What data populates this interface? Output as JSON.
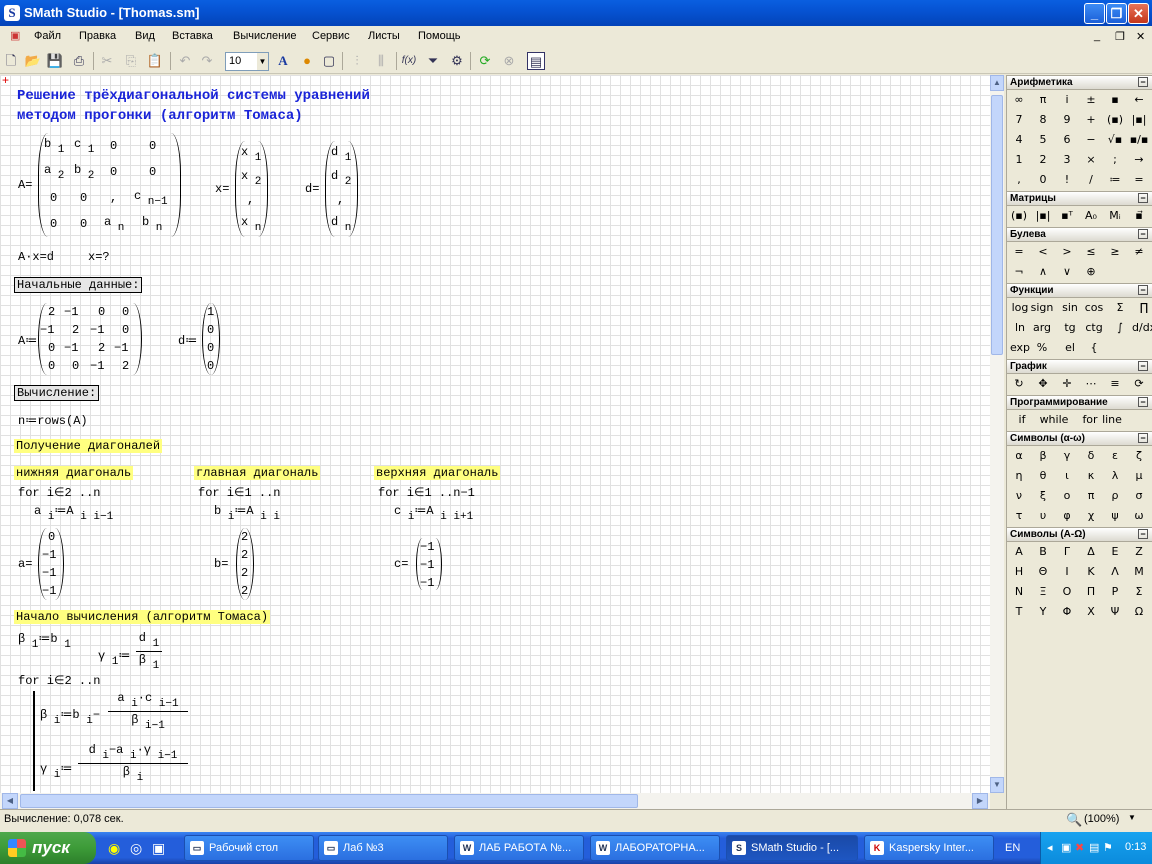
{
  "window": {
    "title": "SMath Studio - [Thomas.sm]",
    "app_icon": "S",
    "btn_min": "_",
    "btn_max": "❐",
    "btn_close": "✕"
  },
  "menu": [
    "Файл",
    "Правка",
    "Вид",
    "Вставка",
    "Вычисление",
    "Сервис",
    "Листы",
    "Помощь"
  ],
  "mdi": {
    "min": "_",
    "restore": "❐",
    "close": "✕"
  },
  "toolbar": {
    "font_size": "10"
  },
  "doc": {
    "title1": "Решение трёхдиагональной системы уравнений",
    "title2": "методом прогонки (алгоритм Томаса)",
    "init_label": "Начальные данные:",
    "calc_label": "Вычисление:",
    "rows_expr": "n≔rows(A)",
    "diag_label": "Получение диагоналей",
    "lower_label": "нижняя диагональ",
    "main_label": "главная диагональ",
    "upper_label": "верхняя диагональ",
    "for_lower": "for i∈2 ..n",
    "for_main": "for i∈1 ..n",
    "for_upper": "for i∈1 ..n−1",
    "start_label": "Начало вычисления (алгоритм Томаса)",
    "for_loop": "for i∈2 ..n",
    "eq_text": "A·x=d",
    "x_question": "x=?"
  },
  "matrix_A_numeric": [
    [
      "2",
      "−1",
      "0",
      "0"
    ],
    [
      "−1",
      "2",
      "−1",
      "0"
    ],
    [
      "0",
      "−1",
      "2",
      "−1"
    ],
    [
      "0",
      "0",
      "−1",
      "2"
    ]
  ],
  "vector_d": [
    "1",
    "0",
    "0",
    "0"
  ],
  "vector_a": [
    "0",
    "−1",
    "−1",
    "−1"
  ],
  "vector_b": [
    "2",
    "2",
    "2",
    "2"
  ],
  "vector_c": [
    "−1",
    "−1",
    "−1"
  ],
  "panels": [
    {
      "name": "Арифметика",
      "items": [
        "∞",
        "π",
        "i",
        "±",
        "▪",
        "←",
        "7",
        "8",
        "9",
        "+",
        "(▪)",
        "|▪|",
        "4",
        "5",
        "6",
        "−",
        "√▪",
        "▪/▪",
        "1",
        "2",
        "3",
        "×",
        ";",
        "→",
        ",",
        "0",
        "!",
        "/",
        "≔",
        "="
      ]
    },
    {
      "name": "Матрицы",
      "items": [
        "(▪)",
        "|▪|",
        "▪ᵀ",
        "A₀",
        "Mᵢ",
        "▪⃗"
      ]
    },
    {
      "name": "Булева",
      "items": [
        "=",
        "<",
        ">",
        "≤",
        "≥",
        "≠",
        "¬",
        "∧",
        "∨",
        "⊕"
      ]
    },
    {
      "name": "Функции",
      "items": [
        "log",
        "sign",
        "sin",
        "cos",
        "Σ",
        "∏",
        "ln",
        "arg",
        "tg",
        "ctg",
        "∫",
        "d/dx",
        "exp",
        "%",
        "el",
        "{"
      ]
    },
    {
      "name": "График",
      "items": [
        "↻",
        "✥",
        "✛",
        "⋯",
        "≡",
        "⟳"
      ]
    },
    {
      "name": "Программирование",
      "items": [
        "if",
        "while",
        "for",
        "line"
      ]
    },
    {
      "name": "Символы (α-ω)",
      "items": [
        "α",
        "β",
        "γ",
        "δ",
        "ε",
        "ζ",
        "η",
        "θ",
        "ι",
        "κ",
        "λ",
        "μ",
        "ν",
        "ξ",
        "ο",
        "π",
        "ρ",
        "σ",
        "τ",
        "υ",
        "φ",
        "χ",
        "ψ",
        "ω"
      ]
    },
    {
      "name": "Символы (А-Ω)",
      "items": [
        "Α",
        "Β",
        "Γ",
        "Δ",
        "Ε",
        "Ζ",
        "Η",
        "Θ",
        "Ι",
        "Κ",
        "Λ",
        "Μ",
        "Ν",
        "Ξ",
        "Ο",
        "Π",
        "Ρ",
        "Σ",
        "Τ",
        "Υ",
        "Φ",
        "Χ",
        "Ψ",
        "Ω"
      ]
    }
  ],
  "status": {
    "text": "Вычисление: 0,078 сек.",
    "zoom": "(100%)"
  },
  "taskbar": {
    "start": "пуск",
    "tasks": [
      "Рабочий стол",
      "Лаб №3",
      "ЛАБ РАБОТА №...",
      "ЛАБОРАТОРНА...",
      "SMath Studio - [...",
      "Kaspersky Inter..."
    ],
    "lang": "EN",
    "time": "0:13"
  }
}
